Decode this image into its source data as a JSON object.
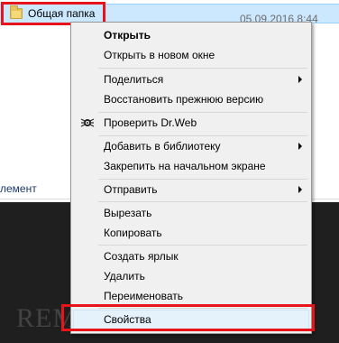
{
  "file": {
    "name": "Общая папка",
    "date": "05.09.2016 8:44",
    "icon": "folder-icon"
  },
  "background": {
    "side_text": "лемент"
  },
  "menu": {
    "open": "Открыть",
    "open_new_window": "Открыть в новом окне",
    "share": "Поделиться",
    "restore_previous": "Восстановить прежнюю версию",
    "check_drweb": "Проверить Dr.Web",
    "add_library": "Добавить в библиотеку",
    "pin_start": "Закрепить на начальном экране",
    "send_to": "Отправить",
    "cut": "Вырезать",
    "copy": "Копировать",
    "create_shortcut": "Создать ярлык",
    "delete": "Удалить",
    "rename": "Переименовать",
    "properties": "Свойства"
  },
  "watermark": "REMONTKA.COM",
  "colors": {
    "highlight_red": "#e8141b",
    "selection_blue": "#cce8ff",
    "menu_bg": "#f0f0f0"
  }
}
